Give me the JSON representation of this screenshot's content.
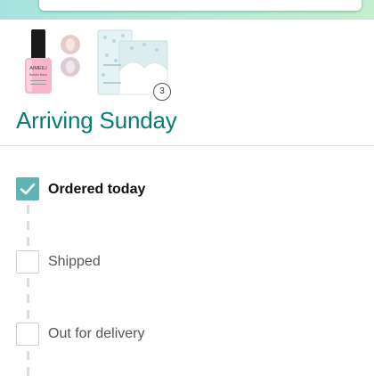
{
  "header": {
    "search": {
      "placeholder": ""
    }
  },
  "products": [
    {
      "name": "nail-polish",
      "brand_text": "AIMEILI",
      "label_text": "Builder Base"
    },
    {
      "name": "tissue-box",
      "quantity": "3"
    }
  ],
  "delivery": {
    "arrival_text": "Arriving Sunday"
  },
  "timeline": {
    "steps": [
      {
        "label": "Ordered today",
        "completed": true
      },
      {
        "label": "Shipped",
        "completed": false
      },
      {
        "label": "Out for delivery",
        "completed": false
      }
    ]
  },
  "colors": {
    "accent": "#067d74",
    "check_fill": "#5fb3b3",
    "header_gradient_start": "#a6e3e0",
    "header_gradient_end": "#c4eed0"
  }
}
